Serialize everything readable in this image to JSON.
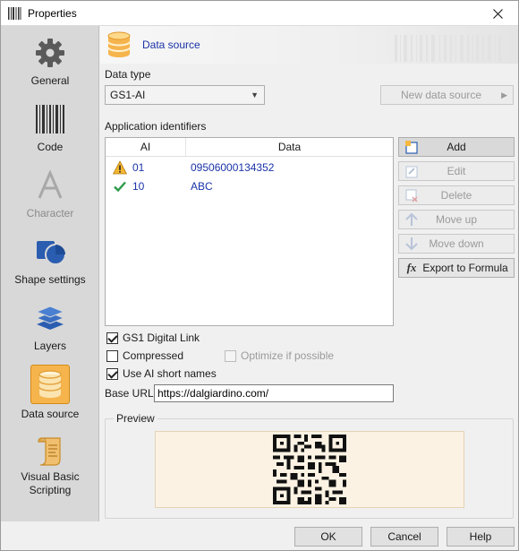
{
  "window": {
    "title": "Properties"
  },
  "sidebar": {
    "items": [
      {
        "label": "General",
        "icon": "gear-icon"
      },
      {
        "label": "Code",
        "icon": "barcode-icon"
      },
      {
        "label": "Character",
        "icon": "character-a-icon"
      },
      {
        "label": "Shape settings",
        "icon": "shapes-icon"
      },
      {
        "label": "Layers",
        "icon": "layers-icon"
      },
      {
        "label": "Data source",
        "icon": "database-icon"
      },
      {
        "label": "Visual Basic\nScripting",
        "icon": "script-scroll-icon"
      }
    ],
    "selected": "Data source"
  },
  "header": {
    "title": "Data source"
  },
  "data_type": {
    "label": "Data type",
    "value": "GS1-AI"
  },
  "new_data_source": {
    "label": "New data source"
  },
  "app_ids": {
    "label": "Application identifiers",
    "columns": [
      "AI",
      "Data"
    ],
    "rows": [
      {
        "status": "warning",
        "ai": "01",
        "data": "09506000134352"
      },
      {
        "status": "ok",
        "ai": "10",
        "data": "ABC"
      }
    ]
  },
  "actions": {
    "add": "Add",
    "edit": "Edit",
    "delete": "Delete",
    "move_up": "Move up",
    "move_down": "Move down",
    "export": "Export to Formula"
  },
  "options": {
    "digital_link": {
      "label": "GS1 Digital Link",
      "checked": true
    },
    "compressed": {
      "label": "Compressed",
      "checked": false
    },
    "optimize": {
      "label": "Optimize if possible",
      "checked": false,
      "enabled": false
    },
    "short_names": {
      "label": "Use AI short names",
      "checked": true
    }
  },
  "base_url": {
    "label": "Base URL:",
    "value": "https://dalgiardino.com/"
  },
  "preview": {
    "label": "Preview"
  },
  "footer": {
    "ok": "OK",
    "cancel": "Cancel",
    "help": "Help"
  },
  "colors": {
    "accent_link": "#1a33a8",
    "selected_nav": "#f6b44d",
    "preview_bg": "#fbf2e3"
  }
}
